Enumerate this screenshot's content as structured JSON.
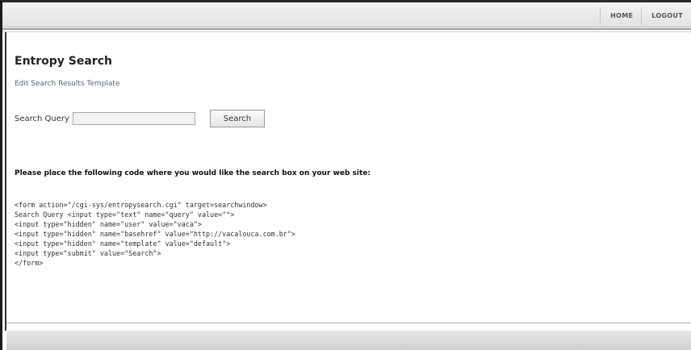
{
  "nav": {
    "home": "HOME",
    "logout": "LOGOUT"
  },
  "page": {
    "title": "Entropy Search",
    "edit_link": "Edit Search Results Template"
  },
  "search": {
    "label": "Search Query",
    "input_value": "",
    "button_label": "Search"
  },
  "instructions": "Please place the following code where you would like the search box on your web site:",
  "code_lines": [
    "<form action=\"/cgi-sys/entropysearch.cgi\" target=searchwindow>",
    "Search Query <input type=\"text\" name=\"query\" value=\"\">",
    "<input type=\"hidden\" name=\"user\" value=\"vaca\">",
    "<input type=\"hidden\" name=\"basehref\" value=\"http://vacalouca.com.br\">",
    "<input type=\"hidden\" name=\"template\" value=\"default\">",
    "<input type=\"submit\" value=\"Search\">",
    "</form>"
  ],
  "colors": {
    "link": "#4a6a8a",
    "topbar": "#ececec",
    "footer": "#d8d8d8"
  }
}
